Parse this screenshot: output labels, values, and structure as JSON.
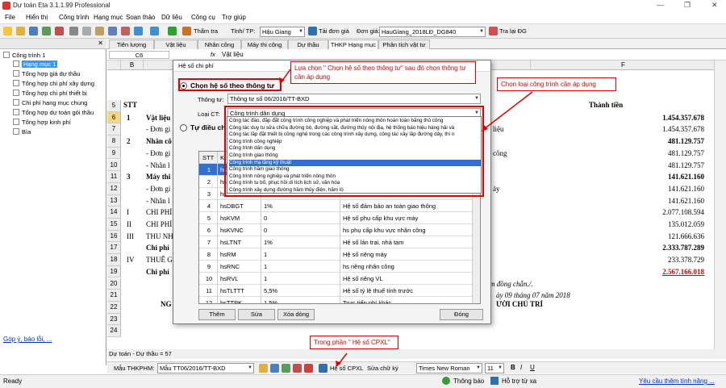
{
  "window": {
    "title": "Dự toán Eta 3.1.1.99 Professional",
    "controls": [
      "—",
      "❐",
      "✕"
    ]
  },
  "menu": [
    "File",
    "Hiển thị",
    "Công trình",
    "Hạng mục",
    "Soạn thảo",
    "Dữ liệu",
    "Công cụ",
    "Trợ giúp"
  ],
  "toolbar": {
    "check_label": "Thẩm tra",
    "province_label": "Tỉnh/ TP:",
    "province_value": "Hậu Giang",
    "load_price_label": "Tải đơn giá",
    "price_label": "Đơn giá:",
    "price_value": "HauGiang_2018LĐ_DG840",
    "lookup_label": "Tra lại ĐG"
  },
  "tree": {
    "root": "Công trình 1",
    "items": [
      "Hạng mục 1",
      "Tổng hợp giá dự thầu",
      "Tổng hợp chi phí xây dựng",
      "Tổng hợp chi phí thiết bị",
      "Chi phí hạng mục chung",
      "Tổng hợp dự toán gói thầu",
      "Tổng hợp kinh phí",
      "Bìa"
    ],
    "feedback_link": "Góp ý, báo lỗi, ..."
  },
  "tabs": [
    "Tiên lượng",
    "Vật liệu",
    "Nhân công",
    "Máy thi công",
    "Dự thầu",
    "THKP Hạng mục",
    "Phân tích vật tư"
  ],
  "formula_bar": {
    "cell_ref": "C6",
    "fx": "fx",
    "content": "Vật liệu"
  },
  "sheet": {
    "col_headers": [
      "B",
      "F"
    ],
    "header_stt": "STT",
    "header_amount": "Thành tiền",
    "rows": [
      {
        "num": "5",
        "stt": "",
        "text": "",
        "suffix": "",
        "amount": ""
      },
      {
        "num": "6",
        "stt": "1",
        "text": "Vật liệu",
        "suffix": "",
        "amount": "1.454.357.678",
        "bold": true
      },
      {
        "num": "7",
        "stt": "",
        "text": "- Đơn gi",
        "suffix": "liệu",
        "amount": "1.454.357.678"
      },
      {
        "num": "8",
        "stt": "2",
        "text": "Nhân cô",
        "suffix": "",
        "amount": "481.129.757",
        "bold": true
      },
      {
        "num": "9",
        "stt": "",
        "text": "- Đơn gi",
        "suffix": "công",
        "amount": "481.129.757"
      },
      {
        "num": "10",
        "stt": "",
        "text": "- Nhân l",
        "suffix": "",
        "amount": "481.129.757"
      },
      {
        "num": "11",
        "stt": "3",
        "text": "Máy thi",
        "suffix": "",
        "amount": "141.621.160",
        "bold": true
      },
      {
        "num": "12",
        "stt": "",
        "text": "- Đơn gi",
        "suffix": "áy",
        "amount": "141.621.160"
      },
      {
        "num": "13",
        "stt": "",
        "text": "- Nhân l",
        "suffix": "",
        "amount": "141.621.160"
      },
      {
        "num": "14",
        "stt": "I",
        "text": "CHI PHÍ",
        "suffix": "",
        "amount": "2.077.108.594"
      },
      {
        "num": "15",
        "stt": "II",
        "text": "CHI PHÍ",
        "suffix": "",
        "amount": "135.012.059"
      },
      {
        "num": "16",
        "stt": "III",
        "text": "THU NH",
        "suffix": "",
        "amount": "121.666.636"
      },
      {
        "num": "17",
        "stt": "",
        "text": "Chi phí",
        "suffix": "",
        "amount": "2.333.787.289",
        "bold": true
      },
      {
        "num": "18",
        "stt": "IV",
        "text": "THUẾ G",
        "suffix": "",
        "amount": "233.378.729"
      },
      {
        "num": "19",
        "stt": "",
        "text": "Chi phí",
        "suffix": "",
        "amount": "2.567.166.018",
        "bold": true,
        "red": true
      }
    ],
    "extra_rows": [
      "20",
      "21",
      "22",
      "23",
      "24"
    ],
    "footer_note": "m đồng chẵn./.",
    "date_text": "ày 09 tháng 07 năm 2018",
    "sign_left": "NG",
    "sign_right": "ƯỜI CHỦ TRÌ"
  },
  "bottom": {
    "sheet_summary": "Dự toán - Dự thầu = 57",
    "template_label": "Mẫu THKPHM:",
    "template_value": "Mẫu TT06/2016/TT-BXD",
    "coef_label": "Hệ số CPXL",
    "edit_label": "Sửa chữ ký",
    "font_value": "Times New Roman",
    "font_size": "11"
  },
  "status": {
    "ready": "Ready",
    "notify": "Thông báo",
    "remote": "Hỗ trợ từ xa",
    "request": "Yêu cầu thêm tính năng ..."
  },
  "dialog": {
    "title": "Hệ số chi phí",
    "option1": "Chọn hệ số theo thông tư",
    "circular_label": "Thông tư:",
    "circular_value": "Thông tư số 06/2016/TT-BXD",
    "type_label": "Loại CT:",
    "type_value": "Công trình dân dụng",
    "option2": "Tự điều ch",
    "table_header": {
      "stt": "STT",
      "k": "K"
    },
    "rows": [
      {
        "stt": "1",
        "code": "hs",
        "val": "",
        "desc": ""
      },
      {
        "stt": "2",
        "code": "hs",
        "val": "",
        "desc": ""
      },
      {
        "stt": "3",
        "code": "hs",
        "val": "",
        "desc": ""
      },
      {
        "stt": "4",
        "code": "hsDBGT",
        "val": "1%",
        "desc": "Hệ số đảm bảo an toàn giao thông"
      },
      {
        "stt": "5",
        "code": "hsKVM",
        "val": "0",
        "desc": "Hệ số phụ cấp khu vực máy"
      },
      {
        "stt": "6",
        "code": "hsKVNC",
        "val": "0",
        "desc": "hs phụ cấp khu vực nhân công"
      },
      {
        "stt": "7",
        "code": "hsLTNT",
        "val": "1%",
        "desc": "Hệ số lán trại, nhà tạm"
      },
      {
        "stt": "8",
        "code": "hsRM",
        "val": "1",
        "desc": "Hệ số riêng máy"
      },
      {
        "stt": "9",
        "code": "hsRNC",
        "val": "1",
        "desc": "hs riêng nhân công"
      },
      {
        "stt": "10",
        "code": "hsRVL",
        "val": "1",
        "desc": "Hệ số riêng VL"
      },
      {
        "stt": "11",
        "code": "hsTLTTT",
        "val": "5,5%",
        "desc": "Hệ số tỷ lệ thuế tính trước"
      },
      {
        "stt": "12",
        "code": "hsTTPK",
        "val": "1,5%",
        "desc": "Trực tiếp phí khác"
      }
    ],
    "buttons": {
      "add": "Thêm",
      "edit": "Sửa",
      "delete": "Xóa dòng",
      "close": "Đóng"
    }
  },
  "dropdown_options": [
    "Công tác đào, đắp đất công trình công nghiệp và phát triển nông thôn hoàn toàn bằng thủ công",
    "Công tác duy tu sửa chữa đường bộ, đường sắt, đường thủy nội địa, hệ thống báo hiệu hàng hải và",
    "Công tác lắp đặt thiết bị công nghệ trong các công trình xây dựng, công tác xây lắp đường dây, thí n",
    "Công trình công nghiệp",
    "Công trình dân dụng",
    "Công trình giao thông",
    "Công trình Hạ tầng kỹ thuật",
    "Công trình hầm giao thông",
    "Công trình nông nghiệp và phát triển nông thôn",
    "Công trình tu bổ, phục hồi di tích lịch sử, văn hóa",
    "Công trình xây dựng đường hầm thủy điện, hầm lò"
  ],
  "selected_option_index": 6,
  "annotations": {
    "callout_top": "Lựa chọn \" Chọn hệ số theo thông tư\" sau đó chọn thông tư cần áp dụng",
    "callout_right": "Chọn loại công trình cần áp dụng",
    "callout_bottom": "Trong phần \" Hệ số CPXL\""
  },
  "colors": {
    "annotation_red": "#e00000",
    "selection_blue": "#3070d0",
    "tree_selected": "#3399ff",
    "total_red": "#cc0000"
  }
}
